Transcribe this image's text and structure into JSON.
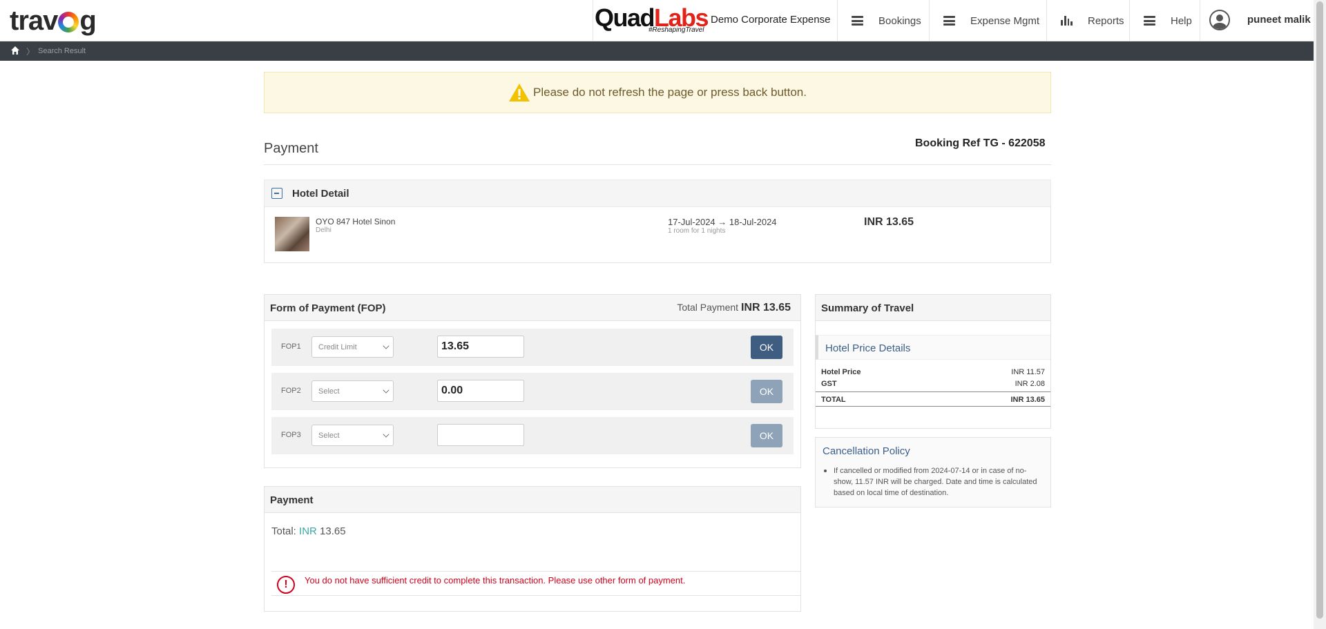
{
  "header": {
    "logo_text": "travog",
    "partner_logo_quad": "Quad",
    "partner_logo_labs": "Labs",
    "partner_tagline": "#ReshapingTravel",
    "company": "Demo Corporate Expense",
    "nav": [
      {
        "label": "Bookings",
        "icon": "menu-icon"
      },
      {
        "label": "Expense Mgmt",
        "icon": "menu-icon"
      },
      {
        "label": "Reports",
        "icon": "bar-chart-icon"
      },
      {
        "label": "Help",
        "icon": "menu-icon"
      }
    ],
    "user_name": "puneet malik"
  },
  "breadcrumb": {
    "home_icon": "home-icon",
    "current": "Search Result"
  },
  "alert": {
    "icon": "warning-icon",
    "text": "Please do not refresh the page or press back button."
  },
  "payment_page": {
    "title": "Payment",
    "booking_ref": "Booking Ref TG - 622058"
  },
  "hotel_detail": {
    "title": "Hotel Detail",
    "name": "OYO 847 Hotel Sinon",
    "city": "Delhi",
    "dates": "17-Jul-2024 → 18-Jul-2024",
    "rooms": "1 room for 1 nights",
    "price": "INR 13.65"
  },
  "fop": {
    "title": "Form of Payment (FOP)",
    "total_label": "Total Payment",
    "total_value": "INR 13.65",
    "rows": [
      {
        "label": "FOP1",
        "select": "Credit Limit",
        "amount": "13.65",
        "button": "OK",
        "enabled": true
      },
      {
        "label": "FOP2",
        "select": "Select",
        "amount": "0.00",
        "button": "OK",
        "enabled": false
      },
      {
        "label": "FOP3",
        "select": "Select",
        "amount": "",
        "button": "OK",
        "enabled": false
      }
    ]
  },
  "summary": {
    "title": "Summary of Travel",
    "section": "Hotel Price Details",
    "rows": [
      {
        "label": "Hotel Price",
        "value": "INR 11.57"
      },
      {
        "label": "GST",
        "value": "INR 2.08"
      }
    ],
    "total_label": "TOTAL",
    "total_value": "INR 13.65"
  },
  "cancellation": {
    "title": "Cancellation Policy",
    "text": "If cancelled or modified from 2024-07-14 or in case of no-show, 11.57 INR will be charged. Date and time is calculated based on local time of destination."
  },
  "payment": {
    "title": "Payment",
    "total_label": "Total:",
    "currency": "INR",
    "amount": "13.65",
    "error_icon": "exclamation-circle-icon",
    "error": "You do not have sufficient credit to complete this transaction. Please use other form of payment."
  },
  "colors": {
    "accent": "#3f5d80",
    "error": "#d0021b",
    "alert_bg": "#fcf8e3",
    "brand_red": "#e2231a"
  }
}
